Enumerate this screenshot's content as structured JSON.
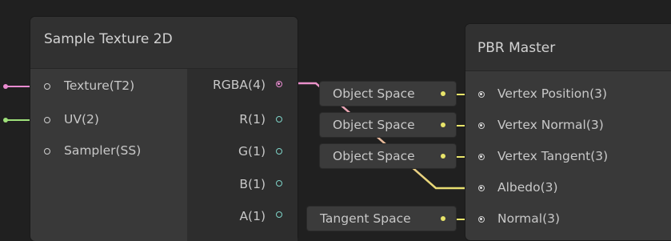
{
  "nodes": {
    "sample_texture": {
      "title": "Sample Texture 2D",
      "inputs": [
        "Texture(T2)",
        "UV(2)",
        "Sampler(SS)"
      ],
      "outputs": [
        "RGBA(4)",
        "R(1)",
        "G(1)",
        "B(1)",
        "A(1)"
      ]
    },
    "pbr_master": {
      "title": "PBR Master",
      "inputs": [
        "Vertex Position(3)",
        "Vertex Normal(3)",
        "Vertex Tangent(3)",
        "Albedo(3)",
        "Normal(3)"
      ],
      "fields": [
        "Object Space",
        "Object Space",
        "Object Space",
        "Tangent Space"
      ]
    }
  },
  "colors": {
    "texture_wire": "#e98bd0",
    "uv_wire": "#9ee07a",
    "vector3_wire": "#e8e46a",
    "rgba_to_albedo_gradient_start": "#e98bd0",
    "rgba_to_albedo_gradient_end": "#e8e46a"
  }
}
